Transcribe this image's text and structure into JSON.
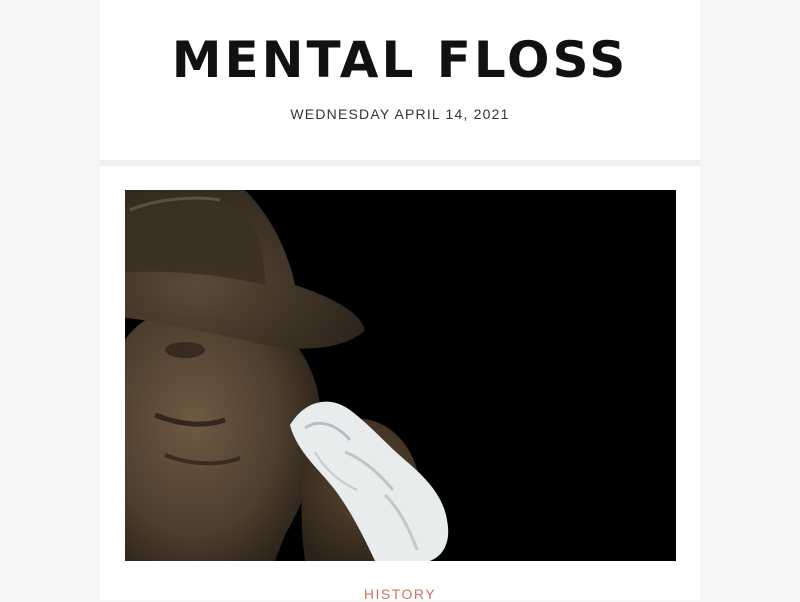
{
  "newsletter": {
    "logo_text": "MENTAL FLOSS",
    "date": "WEDNESDAY APRIL 14, 2021"
  },
  "article": {
    "category": "HISTORY",
    "category_color": "#d0735c"
  },
  "colors": {
    "page_background": "#f6f6f6",
    "card_background": "#ffffff",
    "divider": "#efefef",
    "image_background": "#000000"
  }
}
